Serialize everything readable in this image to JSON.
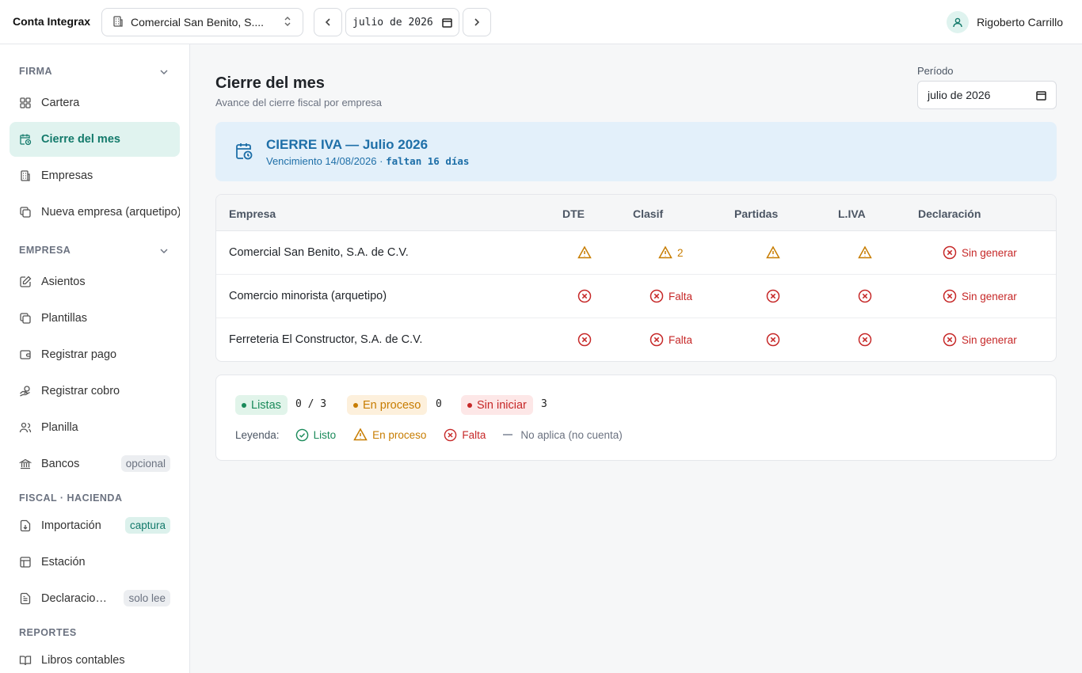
{
  "app": {
    "title": "Conta Integrax"
  },
  "header": {
    "company_select": "Comercial San Benito, S....",
    "month_value": "julio de 2026",
    "user_name": "Rigoberto Carrillo"
  },
  "sidebar": {
    "sections": [
      {
        "label": "FIRMA"
      },
      {
        "label": "EMPRESA"
      },
      {
        "label": "FISCAL · HACIENDA"
      },
      {
        "label": "REPORTES"
      }
    ],
    "items": [
      {
        "label": "Cartera",
        "icon": "grid-icon"
      },
      {
        "label": "Cierre del mes",
        "icon": "calendar-clock-icon",
        "active": true
      },
      {
        "label": "Empresas",
        "icon": "building-icon"
      },
      {
        "label": "Nueva empresa (arquetipo)",
        "icon": "copy-icon"
      },
      {
        "label": "Asientos",
        "icon": "edit-icon"
      },
      {
        "label": "Plantillas",
        "icon": "copy-icon"
      },
      {
        "label": "Registrar pago",
        "icon": "wallet-icon"
      },
      {
        "label": "Registrar cobro",
        "icon": "hand-coins-icon"
      },
      {
        "label": "Planilla",
        "icon": "users-icon"
      },
      {
        "label": "Bancos",
        "icon": "bank-icon",
        "tag": "opcional"
      },
      {
        "label": "Importación",
        "icon": "file-import-icon",
        "tag": "captura"
      },
      {
        "label": "Estación",
        "icon": "table-icon"
      },
      {
        "label": "Declaraciones",
        "icon": "file-text-icon",
        "tag": "solo lee"
      },
      {
        "label": "Libros contables",
        "icon": "book-icon"
      }
    ]
  },
  "main": {
    "title": "Cierre del mes",
    "subtitle": "Avance del cierre fiscal por empresa",
    "period_label": "Período",
    "period_value": "julio de 2026",
    "banner": {
      "title": "CIERRE IVA — Julio 2026",
      "due": "Vencimiento 14/08/2026 · ",
      "remaining": "faltan 16 días"
    },
    "table": {
      "headers": [
        "Empresa",
        "DTE",
        "Clasif",
        "Partidas",
        "L.IVA",
        "Declaración"
      ],
      "rows": [
        {
          "name": "Comercial San Benito, S.A. de C.V.",
          "clasif_text": "2",
          "decl_text": "Sin generar"
        },
        {
          "name": "Comercio minorista (arquetipo)",
          "clasif_text": "Falta",
          "decl_text": "Sin generar"
        },
        {
          "name": "Ferreteria El Constructor, S.A. de C.V.",
          "clasif_text": "Falta",
          "decl_text": "Sin generar"
        }
      ]
    },
    "summary": {
      "listas_label": "Listas",
      "listas_count": "0 / 3",
      "proceso_label": "En proceso",
      "proceso_count": "0",
      "sin_label": "Sin iniciar",
      "sin_count": "3",
      "legend_title": "Leyenda:",
      "legend_listo": "Listo",
      "legend_proceso": "En proceso",
      "legend_falta": "Falta",
      "legend_na": "No aplica (no cuenta)"
    }
  },
  "colors": {
    "accent": "#137a6b",
    "warn": "#c77c00",
    "error": "#c62828",
    "ok": "#1a8a5a",
    "info": "#1e6fa8"
  }
}
